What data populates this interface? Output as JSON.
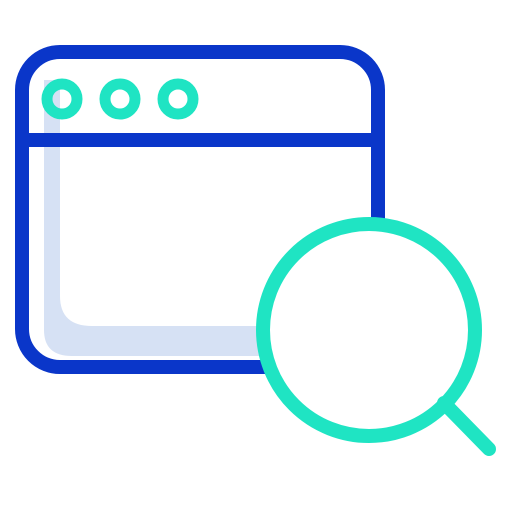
{
  "icon": {
    "name": "browser-search-icon",
    "colors": {
      "primary": "#0A36C9",
      "accent": "#1FE4C3",
      "fill": "#D6E1F4",
      "background": "#FFFFFF"
    }
  }
}
